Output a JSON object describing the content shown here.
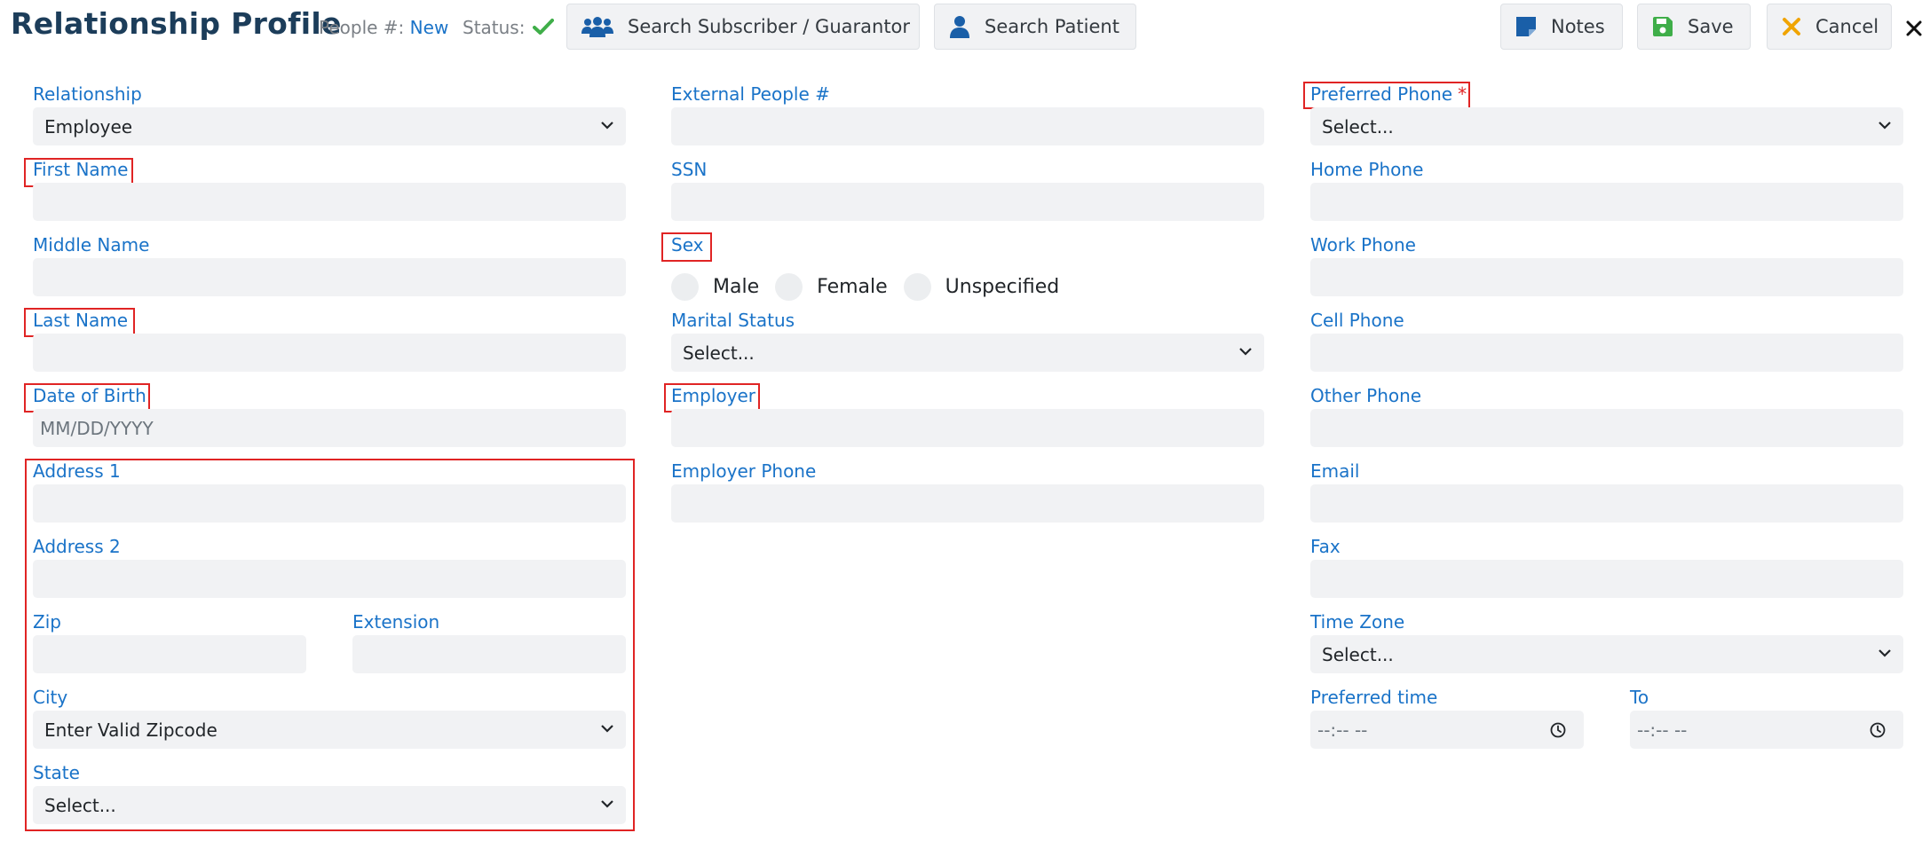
{
  "header": {
    "title": "Relationship Profile",
    "people_label": "People #:",
    "people_value": "New",
    "status_label": "Status:",
    "search_subscriber_label": "Search Subscriber / Guarantor",
    "search_patient_label": "Search Patient",
    "notes_label": "Notes",
    "save_label": "Save",
    "cancel_label": "Cancel"
  },
  "left_column": {
    "relationship": {
      "label": "Relationship",
      "value": "Employee"
    },
    "first_name": {
      "label": "First Name",
      "value": ""
    },
    "middle_name": {
      "label": "Middle Name",
      "value": ""
    },
    "last_name": {
      "label": "Last Name",
      "value": ""
    },
    "date_of_birth": {
      "label": "Date of Birth",
      "placeholder": "MM/DD/YYYY"
    },
    "address1": {
      "label": "Address 1",
      "value": ""
    },
    "address2": {
      "label": "Address 2",
      "value": ""
    },
    "zip": {
      "label": "Zip",
      "value": ""
    },
    "extension": {
      "label": "Extension",
      "value": ""
    },
    "city": {
      "label": "City",
      "value": "Enter Valid Zipcode"
    },
    "state": {
      "label": "State",
      "value": "Select..."
    }
  },
  "middle_column": {
    "external_people": {
      "label": "External People #",
      "value": ""
    },
    "ssn": {
      "label": "SSN",
      "value": ""
    },
    "sex": {
      "label": "Sex",
      "options": [
        "Male",
        "Female",
        "Unspecified"
      ]
    },
    "marital_status": {
      "label": "Marital Status",
      "value": "Select..."
    },
    "employer": {
      "label": "Employer",
      "value": ""
    },
    "employer_phone": {
      "label": "Employer Phone",
      "value": ""
    }
  },
  "right_column": {
    "preferred_phone": {
      "label": "Preferred Phone",
      "required_mark": "*",
      "value": "Select..."
    },
    "home_phone": {
      "label": "Home Phone",
      "value": ""
    },
    "work_phone": {
      "label": "Work Phone",
      "value": ""
    },
    "cell_phone": {
      "label": "Cell Phone",
      "value": ""
    },
    "other_phone": {
      "label": "Other Phone",
      "value": ""
    },
    "email": {
      "label": "Email",
      "value": ""
    },
    "fax": {
      "label": "Fax",
      "value": ""
    },
    "time_zone": {
      "label": "Time Zone",
      "value": "Select..."
    },
    "preferred_time": {
      "label": "Preferred time",
      "value": "--:-- --"
    },
    "to_time": {
      "label": "To",
      "value": "--:-- --"
    }
  },
  "colors": {
    "title": "#1c3d5a",
    "label": "#1a73c8",
    "input_bg": "#f1f2f4",
    "highlight": "#e02424",
    "status_check": "#3fae49",
    "save_icon": "#3fae49",
    "cancel_icon": "#f0a400",
    "icon_blue": "#1a5fa8"
  },
  "icons": {
    "status": "checkmark-icon",
    "subscriber": "users-icon",
    "patient": "user-icon",
    "notes": "sticky-note-icon",
    "save": "floppy-disk-icon",
    "cancel": "x-icon",
    "close": "close-icon",
    "select": "chevron-down-icon",
    "time": "clock-icon"
  }
}
